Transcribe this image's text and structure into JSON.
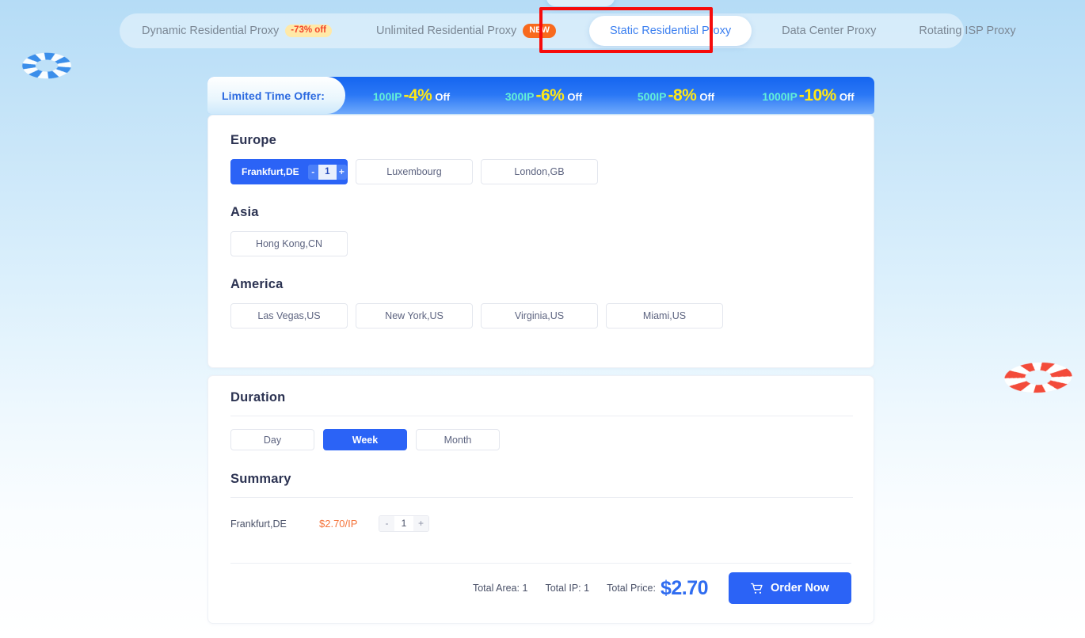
{
  "page": {
    "background_top_color": "#b5dcf6",
    "background_bottom_color": "#ffffff",
    "accent_color": "#2b63f6",
    "price_color": "#f4743b",
    "highlight_box_color": "#f60b0b"
  },
  "decorations": {
    "left_buoy": "lifebuoy-icon-blue",
    "right_buoy": "lifebuoy-icon-red"
  },
  "tabs": [
    {
      "label": "Dynamic Residential Proxy",
      "badge": "-73% off",
      "badge_type": "discount",
      "selected": false
    },
    {
      "label": "Unlimited Residential Proxy",
      "badge": "NEW",
      "badge_type": "new",
      "selected": false
    },
    {
      "label": "Static Residential Proxy",
      "badge": "",
      "badge_type": "",
      "selected": true
    },
    {
      "label": "Data Center Proxy",
      "badge": "",
      "badge_type": "",
      "selected": false
    },
    {
      "label": "Rotating ISP Proxy",
      "badge": "",
      "badge_type": "",
      "selected": false
    }
  ],
  "offer": {
    "label": "Limited Time Offer:",
    "items": [
      {
        "ip": "100IP",
        "pct": "-4%",
        "off": "Off"
      },
      {
        "ip": "300IP",
        "pct": "-6%",
        "off": "Off"
      },
      {
        "ip": "500IP",
        "pct": "-8%",
        "off": "Off"
      },
      {
        "ip": "1000IP",
        "pct": "-10%",
        "off": "Off"
      }
    ]
  },
  "locations": {
    "regions": [
      {
        "title": "Europe",
        "items": [
          {
            "label": "Frankfurt,DE",
            "selected": true,
            "qty": "1",
            "minus": "-",
            "plus": "+"
          },
          {
            "label": "Luxembourg",
            "selected": false
          },
          {
            "label": "London,GB",
            "selected": false
          }
        ]
      },
      {
        "title": "Asia",
        "items": [
          {
            "label": "Hong Kong,CN",
            "selected": false
          }
        ]
      },
      {
        "title": "America",
        "items": [
          {
            "label": "Las Vegas,US",
            "selected": false
          },
          {
            "label": "New York,US",
            "selected": false
          },
          {
            "label": "Virginia,US",
            "selected": false
          },
          {
            "label": "Miami,US",
            "selected": false
          }
        ]
      }
    ]
  },
  "duration": {
    "title": "Duration",
    "options": [
      {
        "label": "Day",
        "selected": false
      },
      {
        "label": "Week",
        "selected": true
      },
      {
        "label": "Month",
        "selected": false
      }
    ]
  },
  "summary": {
    "title": "Summary",
    "rows": [
      {
        "name": "Frankfurt,DE",
        "price": "$2.70/IP",
        "minus": "-",
        "qty": "1",
        "plus": "+"
      }
    ],
    "total_area_label": "Total Area:",
    "total_area_value": "1",
    "total_ip_label": "Total IP:",
    "total_ip_value": "1",
    "total_price_label": "Total Price:",
    "total_price_value": "$2.70",
    "order_button": "Order Now",
    "order_icon": "shopping-cart-icon"
  }
}
